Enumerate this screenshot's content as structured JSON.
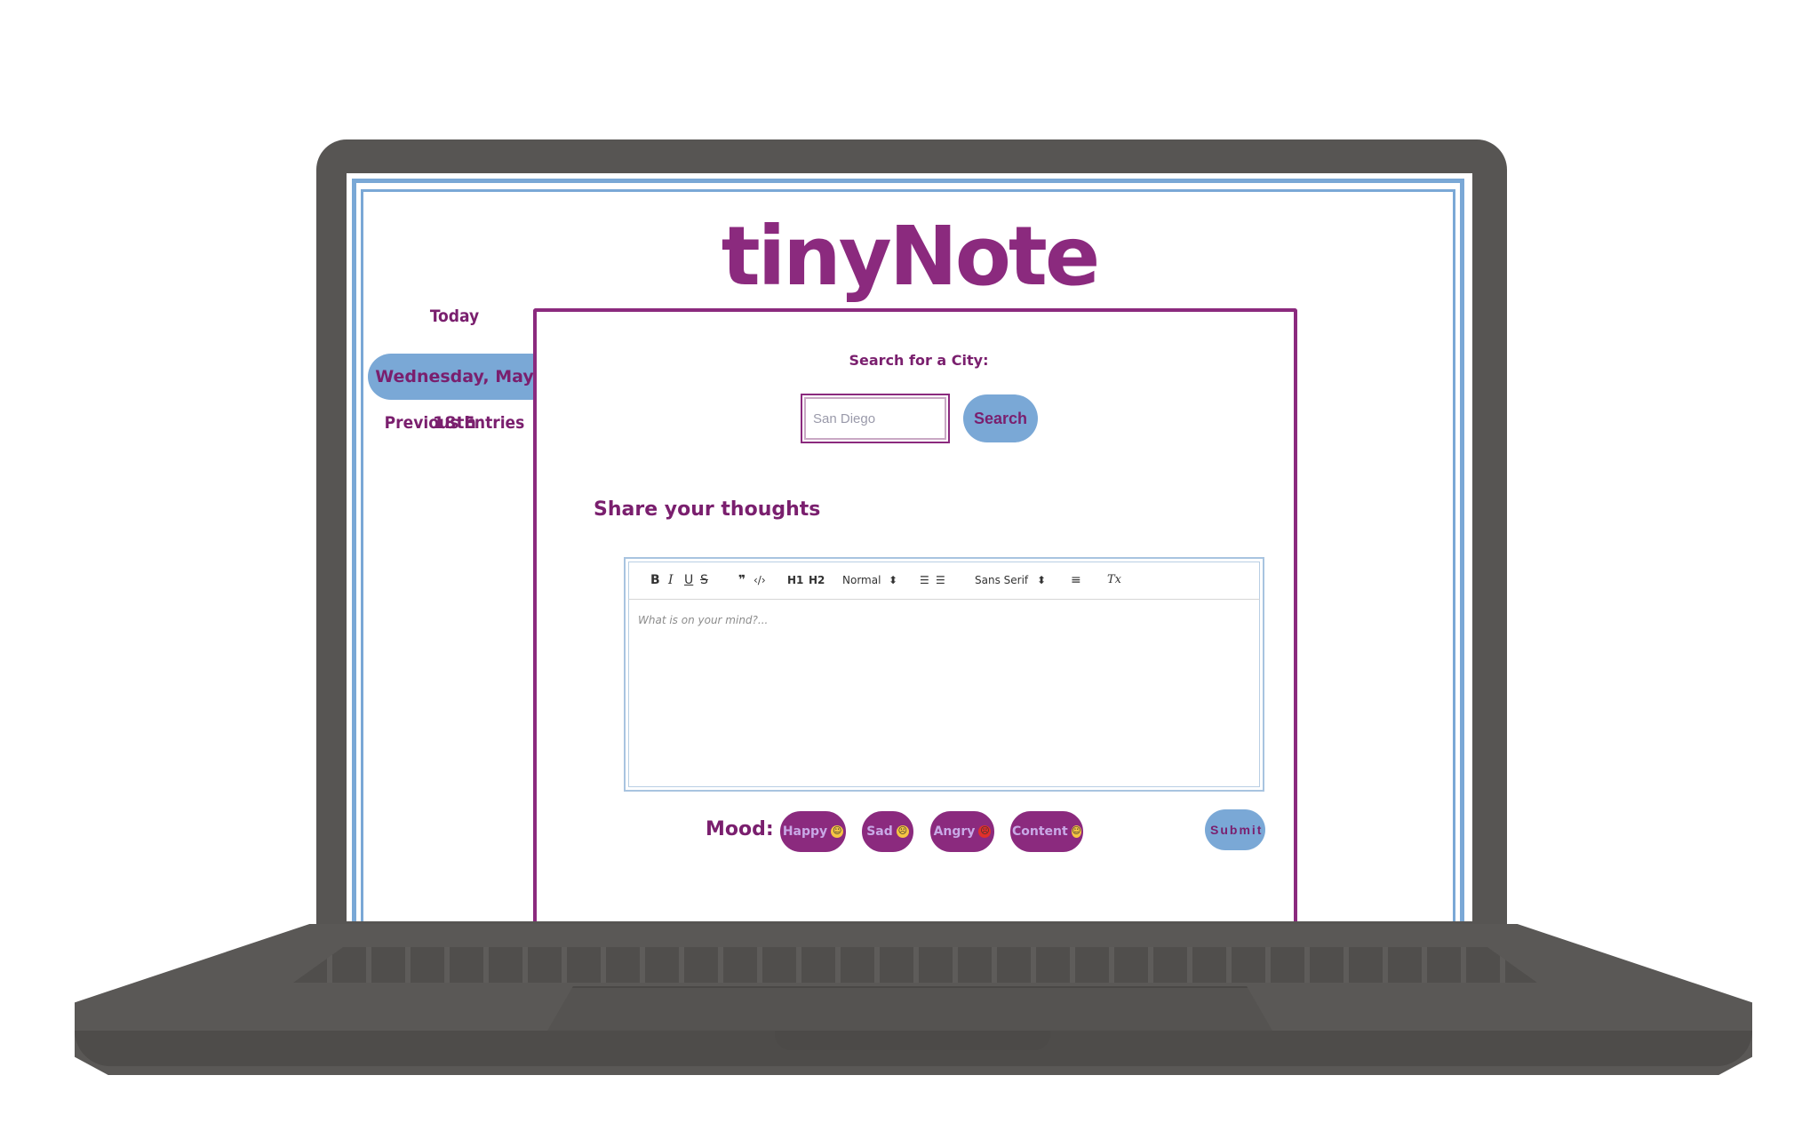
{
  "app": {
    "logo": "tinyNote"
  },
  "nav": {
    "today": "Today",
    "current_date": "Wednesday, May 18th",
    "previous": "Previous Entries"
  },
  "search": {
    "label": "Search for a City:",
    "placeholder": "San Diego",
    "button": "Search"
  },
  "journal": {
    "title": "Share your thoughts",
    "placeholder": "What is on your mind?..."
  },
  "toolbar": {
    "bold": "B",
    "italic": "I",
    "underline": "U",
    "strike": "S",
    "blockquote": "❞",
    "code": "‹/›",
    "h1": "H1",
    "h2": "H2",
    "size": "Normal",
    "font": "Sans Serif",
    "size_arrow": "⬍",
    "font_arrow": "⬍",
    "ordered_list": "☰",
    "bullet_list": "☰",
    "align": "≡",
    "clean": "Tx"
  },
  "mood": {
    "label": "Mood:",
    "options": [
      {
        "label": "Happy",
        "emoji": "😃",
        "emoji_color": "#f5c542"
      },
      {
        "label": "Sad",
        "emoji": "😞",
        "emoji_color": "#f5c542"
      },
      {
        "label": "Angry",
        "emoji": "😡",
        "emoji_color": "#e0302b"
      },
      {
        "label": "Content",
        "emoji": "🙂",
        "emoji_color": "#f5c542"
      }
    ]
  },
  "submit": "Submit",
  "colors": {
    "brand_purple": "#8b2a7e",
    "accent_blue": "#7aa8d6",
    "laptop_gray": "#575553"
  }
}
